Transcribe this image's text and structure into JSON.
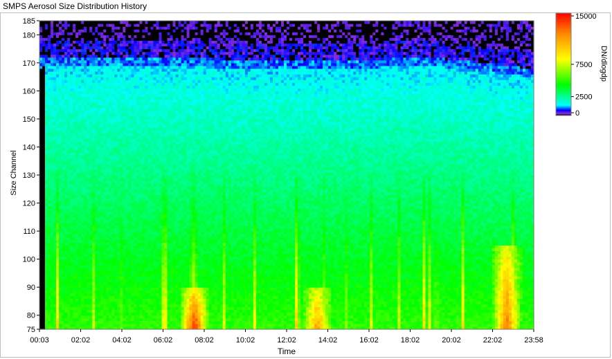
{
  "window": {
    "title": "SMPS Aerosol Size Distribution History"
  },
  "chart_data": {
    "type": "heatmap",
    "title": "",
    "xlabel": "Time",
    "ylabel": "Size Channel",
    "x_ticks": [
      "00:03",
      "02:02",
      "04:02",
      "06:02",
      "08:02",
      "10:02",
      "12:02",
      "14:02",
      "16:02",
      "18:02",
      "20:02",
      "22:02",
      "23:58"
    ],
    "y_ticks": [
      75,
      80,
      90,
      100,
      110,
      120,
      130,
      140,
      150,
      160,
      170,
      180,
      185
    ],
    "ylim": [
      75,
      185
    ],
    "colorbar": {
      "label": "DN/dlogdp",
      "ticks": [
        0,
        2500,
        7500,
        15000
      ],
      "tick_labels": [
        "0",
        "2500",
        "7500",
        "15000"
      ],
      "range": [
        0,
        15000
      ],
      "colors": [
        "#000000",
        "#8a2be2",
        "#0000ff",
        "#00ffff",
        "#00ff00",
        "#ffff00",
        "#ff0000"
      ]
    },
    "grid": false,
    "features": [
      {
        "time": "07:30",
        "size_channel_range": [
          75,
          90
        ],
        "dn_dlogdp": 14000,
        "note": ""
      },
      {
        "time": "13:30",
        "size_channel_range": [
          75,
          90
        ],
        "dn_dlogdp": 11000,
        "note": ""
      },
      {
        "time": "22:45",
        "size_channel_range": [
          75,
          105
        ],
        "dn_dlogdp": 12000,
        "note": ""
      }
    ]
  }
}
